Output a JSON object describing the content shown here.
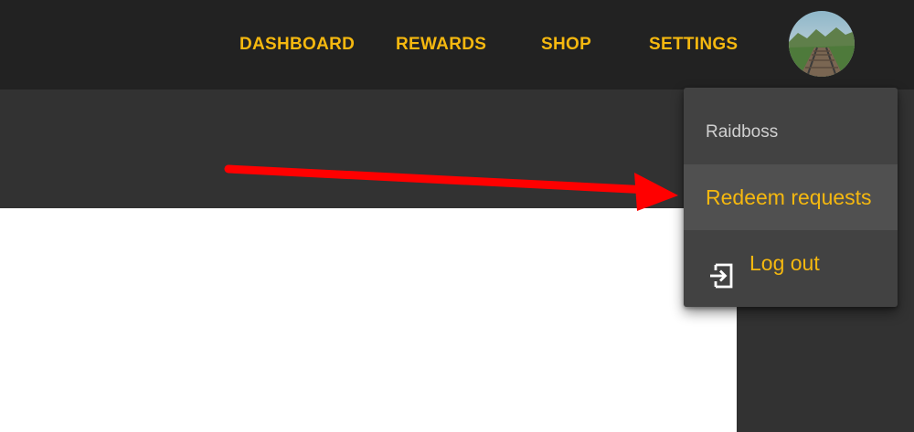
{
  "colors": {
    "accent": "#f5b80f",
    "topbar": "#222222",
    "subbar": "#323232",
    "menu_bg": "#424242",
    "menu_active": "#505050",
    "menu_header_text": "#d0d0d0",
    "annotation_arrow": "#ff0000"
  },
  "nav": {
    "items": [
      {
        "label": "DASHBOARD"
      },
      {
        "label": "REWARDS"
      },
      {
        "label": "SHOP"
      },
      {
        "label": "SETTINGS"
      }
    ]
  },
  "user_menu": {
    "username": "Raidboss",
    "items": [
      {
        "label": "Redeem requests",
        "icon": null,
        "active": true
      },
      {
        "label": "Log out",
        "icon": "logout-icon",
        "active": false
      }
    ]
  }
}
